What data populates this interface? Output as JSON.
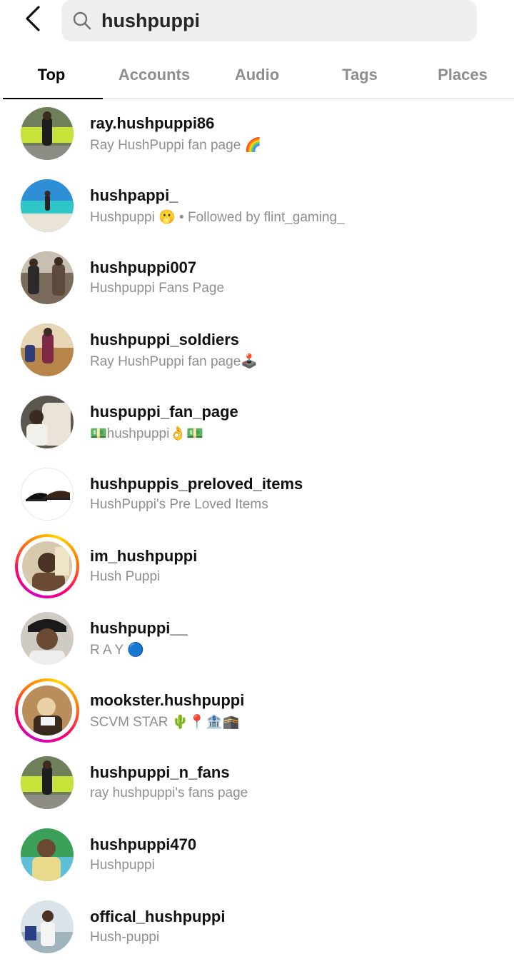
{
  "search": {
    "query": "hushpuppi"
  },
  "tabs": [
    {
      "label": "Top"
    },
    {
      "label": "Accounts"
    },
    {
      "label": "Audio"
    },
    {
      "label": "Tags"
    },
    {
      "label": "Places"
    }
  ],
  "results": [
    {
      "username": "ray.hushpuppi86",
      "subtitle": "Ray HushPuppi fan page 🌈"
    },
    {
      "username": "hushpappi_",
      "subtitle": "Hushpuppi 🫢 • Followed by flint_gaming_"
    },
    {
      "username": "hushpuppi007",
      "subtitle": "Hushpuppi Fans Page"
    },
    {
      "username": "hushpuppi_soldiers",
      "subtitle": "Ray HushPuppi fan page🕹️"
    },
    {
      "username": "huspuppi_fan_page",
      "subtitle": "💵hushpuppi👌💵"
    },
    {
      "username": "hushpuppis_preloved_items",
      "subtitle": "HushPuppi's Pre Loved Items"
    },
    {
      "username": "im_hushpuppi",
      "subtitle": "Hush Puppi"
    },
    {
      "username": "hushpuppi__",
      "subtitle": "R A Y 🔵"
    },
    {
      "username": "mookster.hushpuppi",
      "subtitle": "SCVM STAR 🌵📍🏦🕋"
    },
    {
      "username": "hushpuppi_n_fans",
      "subtitle": "ray hushpuppi's fans page"
    },
    {
      "username": "hushpuppi470",
      "subtitle": "Hushpuppi"
    },
    {
      "username": "offical_hushpuppi",
      "subtitle": "Hush-puppi"
    }
  ]
}
